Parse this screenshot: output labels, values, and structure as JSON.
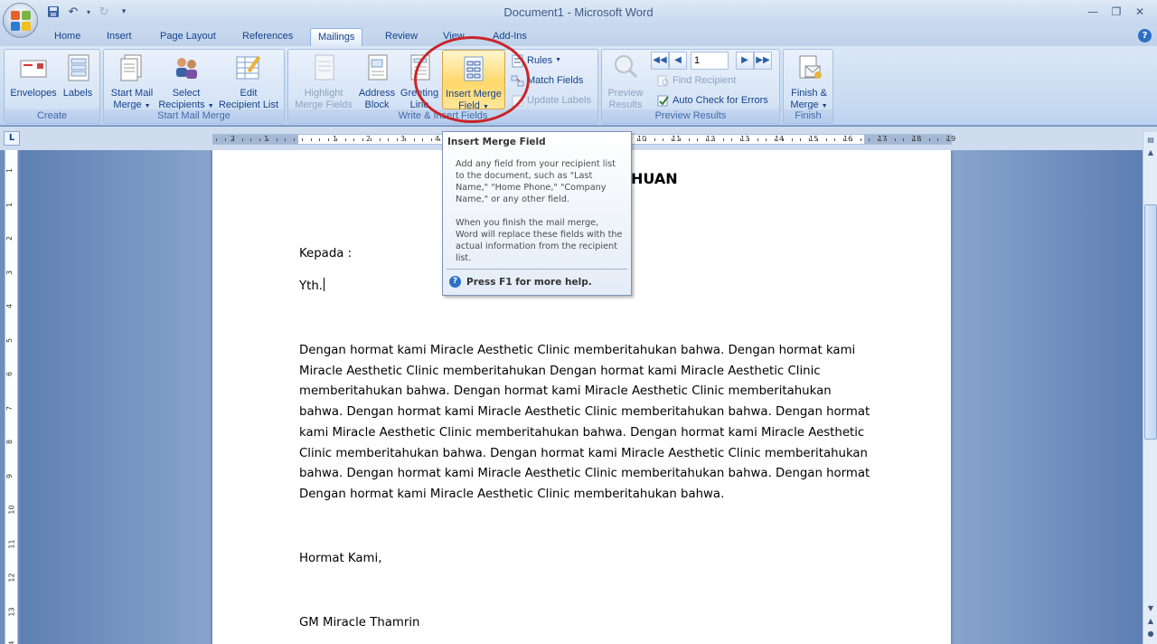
{
  "window": {
    "title": "Document1 - Microsoft Word",
    "minimize_icon": "minimize-icon",
    "restore_icon": "restore-icon",
    "close_icon": "close-icon"
  },
  "quick_access": [
    "save-icon",
    "undo-icon",
    "redo-icon",
    "customize-icon"
  ],
  "tabs": [
    {
      "label": "Home"
    },
    {
      "label": "Insert"
    },
    {
      "label": "Page Layout"
    },
    {
      "label": "References"
    },
    {
      "label": "Mailings",
      "active": true
    },
    {
      "label": "Review"
    },
    {
      "label": "View"
    },
    {
      "label": "Add-Ins"
    }
  ],
  "ribbon": {
    "create": {
      "label": "Create",
      "envelopes": "Envelopes",
      "labels": "Labels"
    },
    "start_mail_merge": {
      "label": "Start Mail Merge",
      "start_line1": "Start Mail",
      "start_line2": "Merge",
      "select_line1": "Select",
      "select_line2": "Recipients",
      "edit_line1": "Edit",
      "edit_line2": "Recipient List"
    },
    "write_insert": {
      "label": "Write & Insert Fields",
      "highlight_line1": "Highlight",
      "highlight_line2": "Merge Fields",
      "address_line1": "Address",
      "address_line2": "Block",
      "greeting_line1": "Greeting",
      "greeting_line2": "Line",
      "insert_line1": "Insert Merge",
      "insert_line2": "Field",
      "rules": "Rules",
      "match_fields": "Match Fields",
      "update_labels": "Update Labels"
    },
    "preview": {
      "label": "Preview Results",
      "preview_line1": "Preview",
      "preview_line2": "Results",
      "record_value": "1",
      "find_recipient": "Find Recipient",
      "auto_check": "Auto Check for Errors"
    },
    "finish": {
      "label": "Finish",
      "finish_line1": "Finish &",
      "finish_line2": "Merge"
    }
  },
  "ruler": {
    "left_numbers": [
      "2",
      "1",
      "1",
      "2",
      "3",
      "4"
    ],
    "right_numbers": [
      "10",
      "11",
      "12",
      "13",
      "14",
      "15",
      "16",
      "17",
      "18",
      "19"
    ]
  },
  "vruler": {
    "numbers": [
      "1",
      "1",
      "2",
      "3",
      "4",
      "5",
      "6",
      "7",
      "8",
      "9",
      "10",
      "11",
      "12",
      "13",
      "14"
    ]
  },
  "tooltip": {
    "title": "Insert Merge Field",
    "para1": "Add any field from your recipient list to the document, such as \"Last Name,\" \"Home Phone,\" \"Company Name,\" or any other field.",
    "para2": "When you finish the mail merge, Word will replace these fields with the actual information from the recipient list.",
    "help": "Press F1 for more help."
  },
  "document": {
    "title_partial": "HUAN",
    "kepada": "Kepada :",
    "yth": "Yth.",
    "body_lines": [
      "Dengan hormat kami Miracle Aesthetic Clinic memberitahukan bahwa. Dengan hormat kami",
      "Miracle Aesthetic Clinic memberitahukan Dengan hormat kami Miracle Aesthetic Clinic",
      "memberitahukan bahwa. Dengan hormat kami Miracle Aesthetic Clinic memberitahukan",
      "bahwa. Dengan hormat kami Miracle Aesthetic Clinic memberitahukan bahwa. Dengan hormat",
      "kami Miracle Aesthetic Clinic memberitahukan bahwa. Dengan hormat kami Miracle Aesthetic",
      "Clinic memberitahukan bahwa. Dengan hormat kami Miracle Aesthetic Clinic memberitahukan",
      "bahwa. Dengan hormat kami Miracle Aesthetic Clinic memberitahukan bahwa. Dengan hormat",
      "Dengan hormat kami Miracle Aesthetic Clinic memberitahukan bahwa."
    ],
    "closing": "Hormat Kami,",
    "signature": "GM Miracle Thamrin"
  },
  "colors": {
    "annotation_circle": "#c8262a",
    "highlight": "#ffd86b"
  }
}
